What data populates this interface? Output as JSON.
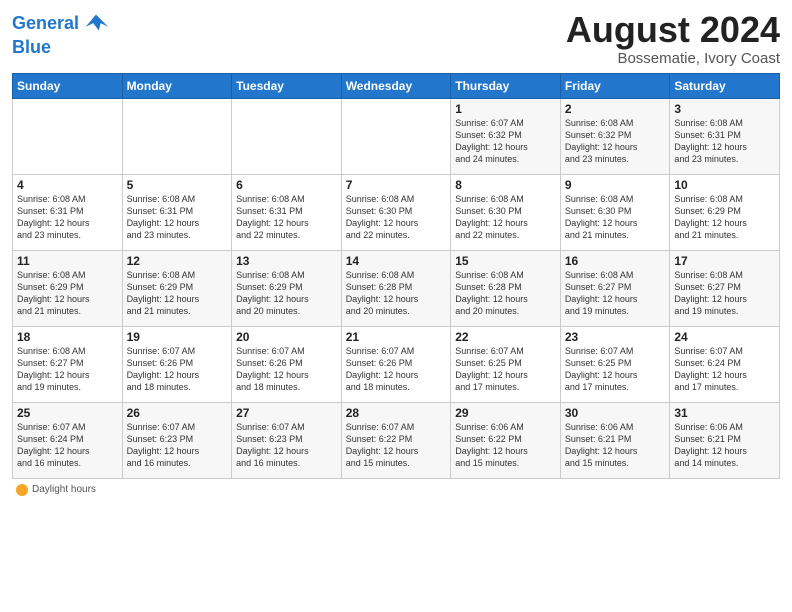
{
  "header": {
    "logo_line1": "General",
    "logo_line2": "Blue",
    "title": "August 2024",
    "subtitle": "Bossematie, Ivory Coast"
  },
  "days_of_week": [
    "Sunday",
    "Monday",
    "Tuesday",
    "Wednesday",
    "Thursday",
    "Friday",
    "Saturday"
  ],
  "weeks": [
    [
      {
        "num": "",
        "info": ""
      },
      {
        "num": "",
        "info": ""
      },
      {
        "num": "",
        "info": ""
      },
      {
        "num": "",
        "info": ""
      },
      {
        "num": "1",
        "info": "Sunrise: 6:07 AM\nSunset: 6:32 PM\nDaylight: 12 hours\nand 24 minutes."
      },
      {
        "num": "2",
        "info": "Sunrise: 6:08 AM\nSunset: 6:32 PM\nDaylight: 12 hours\nand 23 minutes."
      },
      {
        "num": "3",
        "info": "Sunrise: 6:08 AM\nSunset: 6:31 PM\nDaylight: 12 hours\nand 23 minutes."
      }
    ],
    [
      {
        "num": "4",
        "info": "Sunrise: 6:08 AM\nSunset: 6:31 PM\nDaylight: 12 hours\nand 23 minutes."
      },
      {
        "num": "5",
        "info": "Sunrise: 6:08 AM\nSunset: 6:31 PM\nDaylight: 12 hours\nand 23 minutes."
      },
      {
        "num": "6",
        "info": "Sunrise: 6:08 AM\nSunset: 6:31 PM\nDaylight: 12 hours\nand 22 minutes."
      },
      {
        "num": "7",
        "info": "Sunrise: 6:08 AM\nSunset: 6:30 PM\nDaylight: 12 hours\nand 22 minutes."
      },
      {
        "num": "8",
        "info": "Sunrise: 6:08 AM\nSunset: 6:30 PM\nDaylight: 12 hours\nand 22 minutes."
      },
      {
        "num": "9",
        "info": "Sunrise: 6:08 AM\nSunset: 6:30 PM\nDaylight: 12 hours\nand 21 minutes."
      },
      {
        "num": "10",
        "info": "Sunrise: 6:08 AM\nSunset: 6:29 PM\nDaylight: 12 hours\nand 21 minutes."
      }
    ],
    [
      {
        "num": "11",
        "info": "Sunrise: 6:08 AM\nSunset: 6:29 PM\nDaylight: 12 hours\nand 21 minutes."
      },
      {
        "num": "12",
        "info": "Sunrise: 6:08 AM\nSunset: 6:29 PM\nDaylight: 12 hours\nand 21 minutes."
      },
      {
        "num": "13",
        "info": "Sunrise: 6:08 AM\nSunset: 6:29 PM\nDaylight: 12 hours\nand 20 minutes."
      },
      {
        "num": "14",
        "info": "Sunrise: 6:08 AM\nSunset: 6:28 PM\nDaylight: 12 hours\nand 20 minutes."
      },
      {
        "num": "15",
        "info": "Sunrise: 6:08 AM\nSunset: 6:28 PM\nDaylight: 12 hours\nand 20 minutes."
      },
      {
        "num": "16",
        "info": "Sunrise: 6:08 AM\nSunset: 6:27 PM\nDaylight: 12 hours\nand 19 minutes."
      },
      {
        "num": "17",
        "info": "Sunrise: 6:08 AM\nSunset: 6:27 PM\nDaylight: 12 hours\nand 19 minutes."
      }
    ],
    [
      {
        "num": "18",
        "info": "Sunrise: 6:08 AM\nSunset: 6:27 PM\nDaylight: 12 hours\nand 19 minutes."
      },
      {
        "num": "19",
        "info": "Sunrise: 6:07 AM\nSunset: 6:26 PM\nDaylight: 12 hours\nand 18 minutes."
      },
      {
        "num": "20",
        "info": "Sunrise: 6:07 AM\nSunset: 6:26 PM\nDaylight: 12 hours\nand 18 minutes."
      },
      {
        "num": "21",
        "info": "Sunrise: 6:07 AM\nSunset: 6:26 PM\nDaylight: 12 hours\nand 18 minutes."
      },
      {
        "num": "22",
        "info": "Sunrise: 6:07 AM\nSunset: 6:25 PM\nDaylight: 12 hours\nand 17 minutes."
      },
      {
        "num": "23",
        "info": "Sunrise: 6:07 AM\nSunset: 6:25 PM\nDaylight: 12 hours\nand 17 minutes."
      },
      {
        "num": "24",
        "info": "Sunrise: 6:07 AM\nSunset: 6:24 PM\nDaylight: 12 hours\nand 17 minutes."
      }
    ],
    [
      {
        "num": "25",
        "info": "Sunrise: 6:07 AM\nSunset: 6:24 PM\nDaylight: 12 hours\nand 16 minutes."
      },
      {
        "num": "26",
        "info": "Sunrise: 6:07 AM\nSunset: 6:23 PM\nDaylight: 12 hours\nand 16 minutes."
      },
      {
        "num": "27",
        "info": "Sunrise: 6:07 AM\nSunset: 6:23 PM\nDaylight: 12 hours\nand 16 minutes."
      },
      {
        "num": "28",
        "info": "Sunrise: 6:07 AM\nSunset: 6:22 PM\nDaylight: 12 hours\nand 15 minutes."
      },
      {
        "num": "29",
        "info": "Sunrise: 6:06 AM\nSunset: 6:22 PM\nDaylight: 12 hours\nand 15 minutes."
      },
      {
        "num": "30",
        "info": "Sunrise: 6:06 AM\nSunset: 6:21 PM\nDaylight: 12 hours\nand 15 minutes."
      },
      {
        "num": "31",
        "info": "Sunrise: 6:06 AM\nSunset: 6:21 PM\nDaylight: 12 hours\nand 14 minutes."
      }
    ]
  ],
  "footer": {
    "daylight_label": "Daylight hours"
  }
}
